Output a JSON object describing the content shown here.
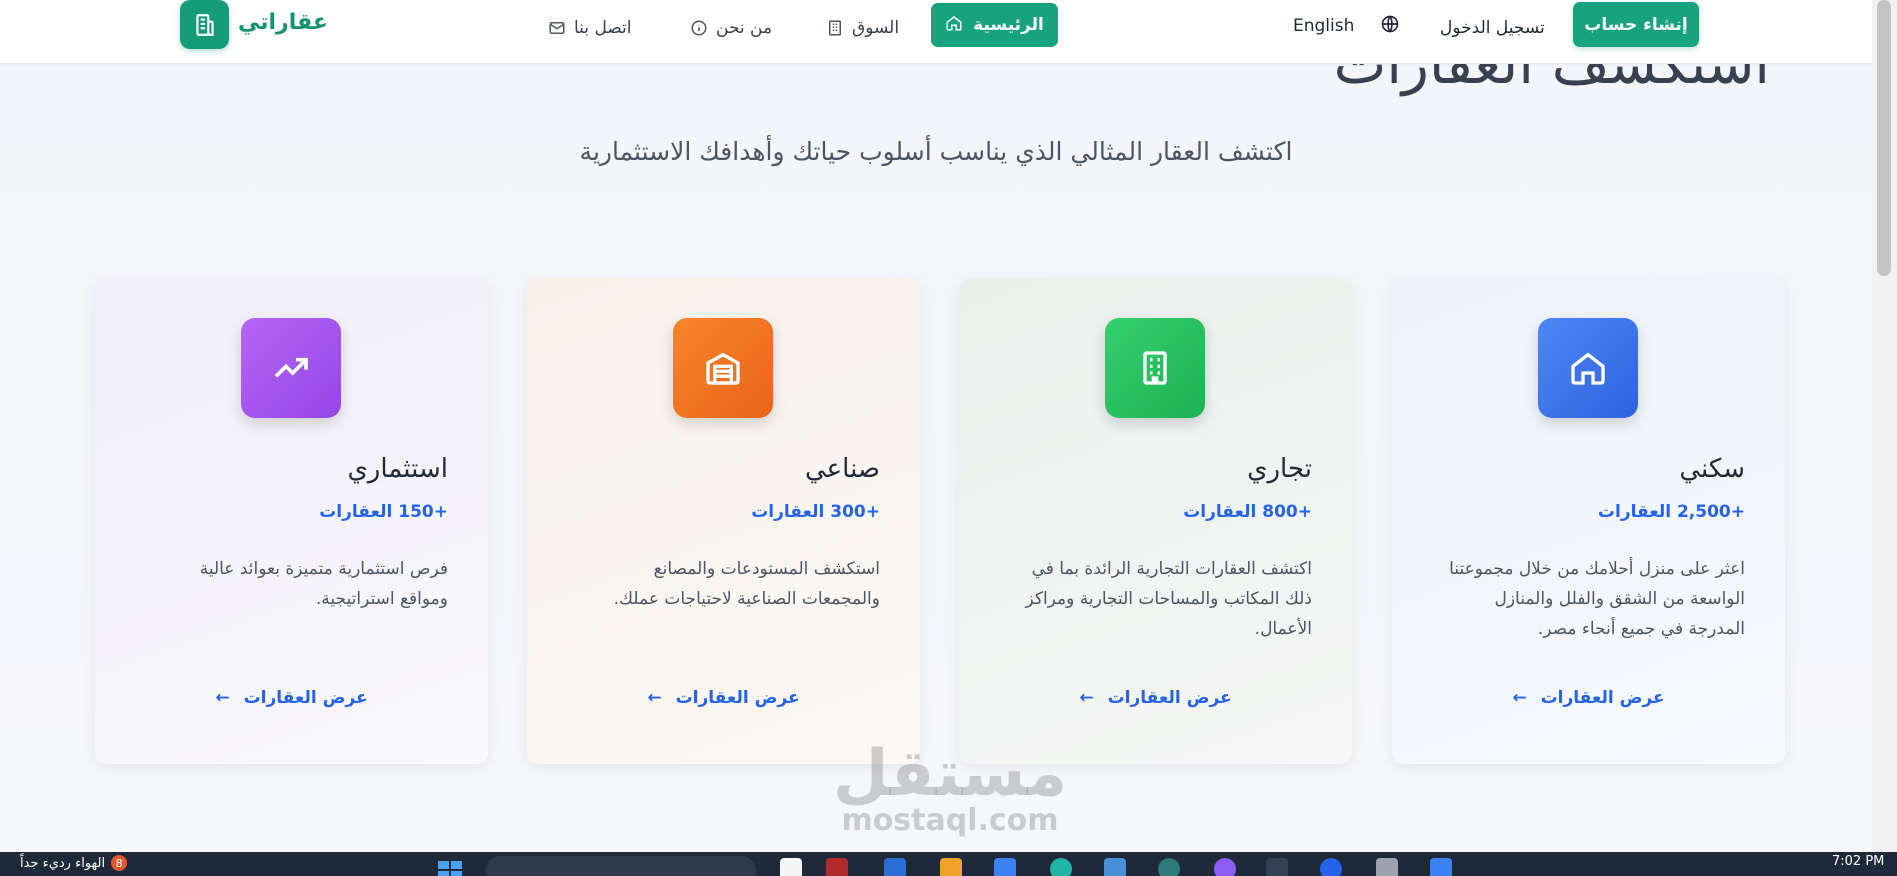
{
  "nav": {
    "brand": "عقاراتي",
    "items": [
      {
        "label": "الرئيسية",
        "icon": "home-icon",
        "active": true
      },
      {
        "label": "السوق",
        "icon": "building-icon"
      },
      {
        "label": "من نحن",
        "icon": "info-icon"
      },
      {
        "label": "اتصل بنا",
        "icon": "mail-icon"
      }
    ],
    "language": "English",
    "login": "تسجيل الدخول",
    "signup": "إنشاء حساب"
  },
  "hero": {
    "title": "استكشف العقارات",
    "subtitle": "اكتشف العقار المثالي الذي يناسب أسلوب حياتك وأهدافك الاستثمارية"
  },
  "cards": [
    {
      "title": "سكني",
      "count": "+2,500 العقارات",
      "description": "اعثر على منزل أحلامك من خلال مجموعتنا الواسعة من الشقق والفلل والمنازل المدرجة في جميع أنحاء مصر.",
      "link": "عرض العقارات",
      "icon": "home-icon",
      "color": "#3b74ec"
    },
    {
      "title": "تجاري",
      "count": "+800 العقارات",
      "description": "اكتشف العقارات التجارية الرائدة بما في ذلك المكاتب والمساحات التجارية ومراكز الأعمال.",
      "link": "عرض العقارات",
      "icon": "office-building-icon",
      "color": "#22c05e"
    },
    {
      "title": "صناعي",
      "count": "+300 العقارات",
      "description": "استكشف المستودعات والمصانع والمجمعات الصناعية لاحتياجات عملك.",
      "link": "عرض العقارات",
      "icon": "warehouse-icon",
      "color": "#f07120"
    },
    {
      "title": "استثماري",
      "count": "+150 العقارات",
      "description": "فرص استثمارية متميزة بعوائد عالية ومواقع استراتيجية.",
      "link": "عرض العقارات",
      "icon": "trending-up-icon",
      "color": "#a855f7"
    }
  ],
  "watermark": {
    "arabic": "مستقل",
    "latin": "mostaql.com"
  },
  "taskbar": {
    "weather": "الهواء رديء جداً",
    "badge": "8",
    "time": "7:02 PM"
  }
}
